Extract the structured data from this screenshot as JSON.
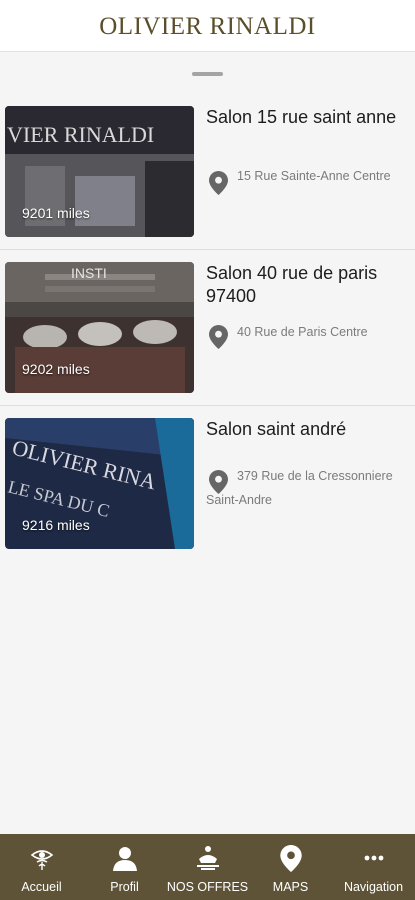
{
  "header": {
    "brand": "OLIVIER RINALDI"
  },
  "salons": [
    {
      "name": "Salon 15 rue saint anne",
      "address": "15 Rue Sainte-Anne Centre",
      "distance": "9201 miles"
    },
    {
      "name": "Salon 40 rue de paris 97400",
      "address": "40 Rue de Paris Centre",
      "distance": "9202 miles"
    },
    {
      "name": "Salon saint andré",
      "address": "379 Rue de la Cressonniere Saint-Andre",
      "distance": "9216 miles"
    }
  ],
  "thumb_text": [
    "VIER RINALDI",
    "INSTI",
    "OLIVIER RINA",
    "LE SPA DU C"
  ],
  "nav": [
    {
      "label": "Accueil",
      "icon": "eye-lotus-icon"
    },
    {
      "label": "Profil",
      "icon": "person-icon"
    },
    {
      "label": "NOS OFFRES",
      "icon": "offers-icon"
    },
    {
      "label": "MAPS",
      "icon": "map-pin-icon"
    },
    {
      "label": "Navigation",
      "icon": "more-dots-icon"
    }
  ],
  "colors": {
    "brand": "#5b4e2a",
    "tabbar": "#5e5336",
    "text": "#1d1d1d",
    "muted": "#7b7b7b"
  }
}
